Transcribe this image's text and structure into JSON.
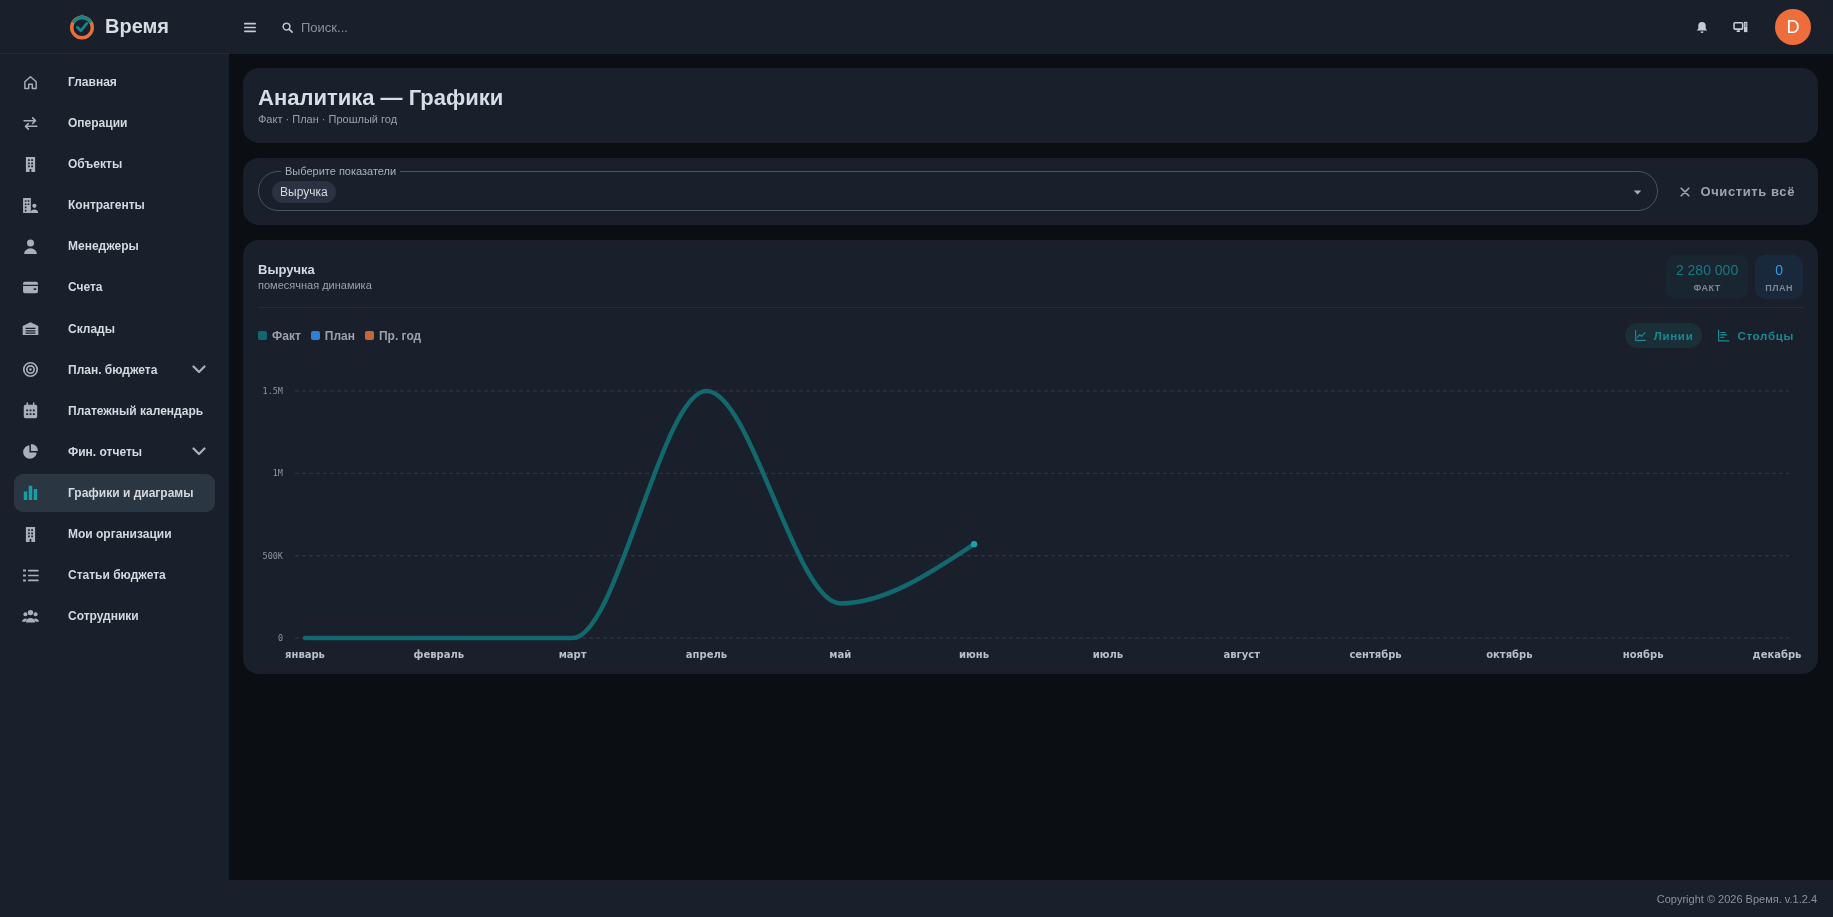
{
  "sidebar": {
    "brand": "Время",
    "items": [
      {
        "label": "Главная",
        "kind": "link",
        "selected": false
      },
      {
        "label": "Операции",
        "kind": "link",
        "selected": false
      },
      {
        "label": "Объекты",
        "kind": "link",
        "selected": false
      },
      {
        "label": "Контрагенты",
        "kind": "link",
        "selected": false
      },
      {
        "label": "Менеджеры",
        "kind": "link",
        "selected": false
      },
      {
        "label": "Счета",
        "kind": "link",
        "selected": false
      },
      {
        "label": "Склады",
        "kind": "link",
        "selected": false
      },
      {
        "label": "План. бюджета",
        "kind": "group",
        "expanded": false,
        "selected": false
      },
      {
        "label": "Платежный календарь",
        "kind": "link",
        "selected": false
      },
      {
        "label": "Фин. отчеты",
        "kind": "group",
        "expanded": false,
        "selected": false
      },
      {
        "label": "Графики и диаграмы",
        "kind": "link",
        "selected": true
      },
      {
        "label": "Мои организации",
        "kind": "link",
        "selected": false
      },
      {
        "label": "Статьи бюджета",
        "kind": "link",
        "selected": false
      },
      {
        "label": "Сотрудники",
        "kind": "link",
        "selected": false
      }
    ]
  },
  "topbar": {
    "search": {
      "placeholder": "Поиск..."
    },
    "avatar": {
      "initial": "D"
    }
  },
  "page_header": {
    "title": "Аналитика — Графики",
    "subtitle": "Факт · План · Прошлый год"
  },
  "filter": {
    "label": "Выберите показатели",
    "chips": [
      "Выручка"
    ],
    "clear_button": "Очистить всё"
  },
  "chart_card": {
    "title": "Выручка",
    "subtitle": "помесячная динамика",
    "stats": [
      {
        "value": "2 280 000",
        "label": "ФАКТ",
        "color": "#157a7f"
      },
      {
        "value": "0",
        "label": "ПЛАН",
        "color": "#2a9ef5"
      }
    ],
    "view_toggle": [
      {
        "label": "Линии",
        "selected": true
      },
      {
        "label": "Столбцы",
        "selected": false
      }
    ],
    "chart_data": {
      "type": "line",
      "grid": true,
      "categories": [
        "январь",
        "февраль",
        "март",
        "апрель",
        "май",
        "июнь",
        "июль",
        "август",
        "сентябрь",
        "октябрь",
        "ноябрь",
        "декабрь"
      ],
      "series": [
        {
          "name": "Факт",
          "color": "#12686d",
          "values": [
            0,
            0,
            0,
            1500000,
            210000,
            570000,
            null,
            null,
            null,
            null,
            null,
            null
          ]
        },
        {
          "name": "План",
          "color": "#2f80d2",
          "values": [
            null,
            null,
            null,
            null,
            null,
            null,
            null,
            null,
            null,
            null,
            null,
            null
          ]
        },
        {
          "name": "Пр. год",
          "color": "#c4653d",
          "values": [
            null,
            null,
            null,
            null,
            null,
            null,
            null,
            null,
            null,
            null,
            null,
            null
          ]
        }
      ],
      "ylim": [
        0,
        1500000
      ],
      "yticks": [
        {
          "value": 0,
          "label": "0"
        },
        {
          "value": 500000,
          "label": "500K"
        },
        {
          "value": 1000000,
          "label": "1M"
        },
        {
          "value": 1500000,
          "label": "1.5M"
        }
      ]
    }
  },
  "footer": {
    "copyright": "Copyright © 2026 Время. v.1.2.4"
  }
}
